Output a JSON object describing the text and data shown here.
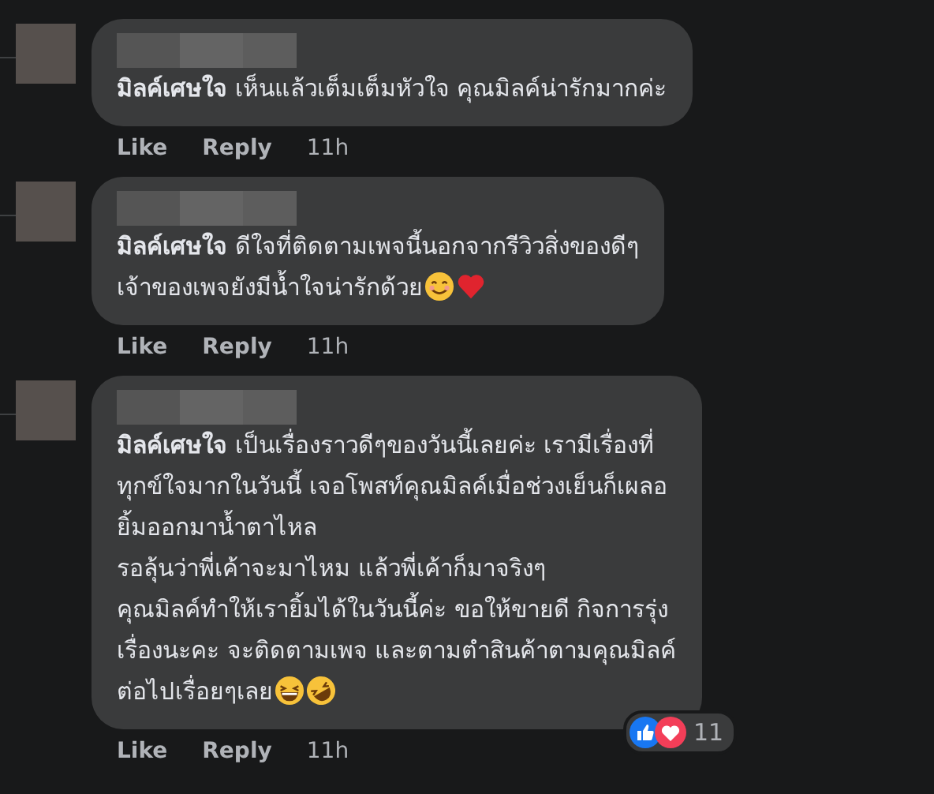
{
  "comments": [
    {
      "text": "**มิลค์เศษใจ** เห็นแล้วเต็มเต็มหัวใจ คุณมิลค์น่ารักมากค่ะ",
      "like": "Like",
      "reply": "Reply",
      "time": "11h"
    },
    {
      "text": "**มิลค์เศษใจ** ดีใจที่ติดตามเพจนี้นอกจากรีวิวสิ่งของดีๆ\nเจ้าของเพจยังมีน้ำใจน่ารักด้วย",
      "emoji": [
        {
          "kind": "smile"
        },
        {
          "kind": "heart"
        }
      ],
      "like": "Like",
      "reply": "Reply",
      "time": "11h"
    },
    {
      "text": "**มิลค์เศษใจ** เป็นเรื่องราวดีๆของวันนี้เลยค่ะ เรามีเรื่องที่\nทุกข์ใจมากในวันนี้ เจอโพสท์คุณมิลค์เมื่อช่วงเย็นก็เผลอ\nยิ้มออกมาน้ำตาไหล\nรอลุ้นว่าพี่เค้าจะมาไหม แล้วพี่เค้าก็มาจริงๆ\nคุณมิลค์ทำให้เรายิ้มได้ในวันนี้ค่ะ ขอให้ขายดี กิจการรุ่ง\nเรื่องนะคะ จะติดตามเพจ และตามตำสินค้าตามคุณมิลค์\nต่อไปเรื่อยๆเลย",
      "emoji": [
        {
          "kind": "laugh"
        },
        {
          "kind": "rofl"
        }
      ],
      "like": "Like",
      "reply": "Reply",
      "time": "11h",
      "reactions": {
        "count": "11"
      }
    }
  ]
}
